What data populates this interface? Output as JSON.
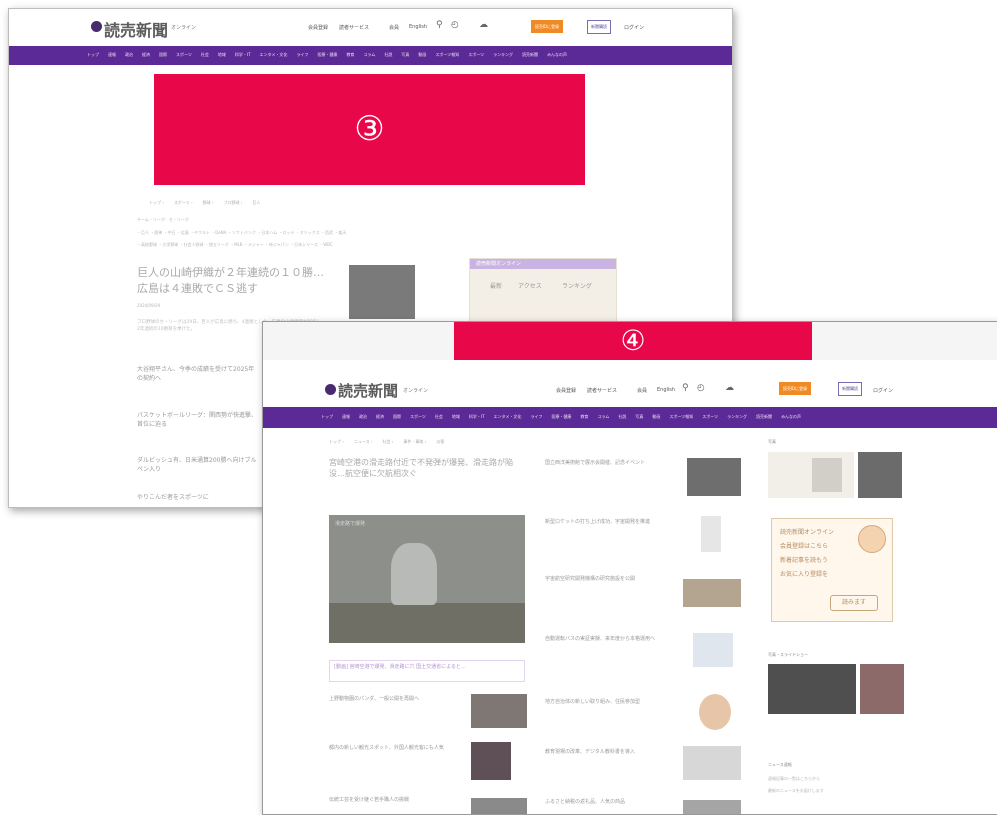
{
  "shot3": {
    "logo": "読売新聞",
    "logo_sub": "オンライン",
    "header_links": [
      "会員登録",
      "読者サービス",
      "会員",
      "English"
    ],
    "paid_button": "読売IDに登録",
    "box_button": "新聞購読",
    "login": "ログイン",
    "nav": [
      "トップ",
      "速報",
      "政治",
      "経済",
      "国際",
      "スポーツ",
      "社会",
      "地域",
      "科学・IT",
      "エンタメ・文化",
      "ライフ",
      "医療・健康",
      "教育",
      "コラム",
      "社説",
      "写真",
      "動画",
      "スポーツ報知",
      "スポーツ",
      "ランキング",
      "読売新聞",
      "みんなの声"
    ],
    "banner_label": "③",
    "breadcrumbs": [
      "トップ",
      "スポーツ",
      "野球",
      "プロ野球",
      "巨人"
    ],
    "tag_row_1": "チーム・リーグ：セ・リーグ",
    "tag_row_2": "・巨人 ・阪神 ・中日 ・広島 ・ヤクルト ・DeNA ・ソフトバンク ・日本ハム ・ロッテ ・オリックス ・西武 ・楽天",
    "tag_row_3": "・高校野球 ・大学野球 ・社会人野球 ・独立リーグ ・MLB ・メジャー ・侍ジャパン ・日本シリーズ ・WBC",
    "headline": "巨人の山崎伊織が２年連続の１０勝…広島は４連敗でＣＳ逃す",
    "date": "2024/09/29",
    "body_preview": "プロ野球のセ・リーグは29日、巨人が広島に勝ち、4連勝とした。先発の山崎伊織が好投し、2年連続の10勝目を挙げた。",
    "related": [
      "大谷翔平さん、今季の成績を受けて2025年の契約へ",
      "パスケットボールリーグ：関西勢が快進撃、首位に迫る",
      "ダルビッシュ有、日米通算200勝へ向けブルペン入り",
      "やりこんだ者をスポーツに"
    ],
    "widget_title": "読売新聞オンライン",
    "widget_tabs": [
      "最新",
      "アクセス",
      "ランキング"
    ]
  },
  "shot4": {
    "banner_label": "④",
    "logo": "読売新聞",
    "logo_sub": "オンライン",
    "header_links": [
      "会員登録",
      "読者サービス",
      "会員",
      "English"
    ],
    "paid_button": "読売IDに登録",
    "box_button": "新聞購読",
    "login": "ログイン",
    "nav": [
      "トップ",
      "速報",
      "政治",
      "経済",
      "国際",
      "スポーツ",
      "社会",
      "地域",
      "科学・IT",
      "エンタメ・文化",
      "ライフ",
      "医療・健康",
      "教育",
      "コラム",
      "社説",
      "写真",
      "動画",
      "スポーツ報知",
      "スポーツ",
      "ランキング",
      "読売新聞",
      "みんなの声"
    ],
    "breadcrumbs": [
      "トップ",
      "ニュース",
      "社会",
      "事件・事故",
      "災害"
    ],
    "headline": "宮崎空港の滑走路付近で不発弾が爆発、滑走路が陥没…航空便に欠航相次ぐ",
    "photo_caption": "滑走路で爆発",
    "photo_note": "[動画] 宮崎空港で爆発、滑走路に穴 国土交通省によると…",
    "side_news": [
      "国立西洋美術館で展示会開催、記念イベント",
      "新型ロケットの打ち上げ成功、宇宙開発を推進",
      "宇宙航空研究開発機構の研究施設を公開",
      "自動運転バスの実証実験、来年度から本格運用へ",
      "地方自治体の新しい取り組み、住民参加型",
      "教育現場の改革、デジタル教科書を導入",
      "ふるさと納税の返礼品、人気の商品"
    ],
    "left_news": [
      "上野動物園のパンダ、一般公開を再開へ",
      "都内の新しい観光スポット、外国人観光客にも人気",
      "伝統工芸を受け継ぐ若手職人の挑戦"
    ],
    "sidebar_title": "写真",
    "sidebar_sub": "写真・スライドショー",
    "note_lines": [
      "読売新聞オンライン",
      "会員登録はこちら",
      "新着記事を読もう",
      "お気に入り登録を"
    ],
    "note_button": "読みます",
    "bottom_title": "ニュース速報",
    "bottom_lines": [
      "速報記事の一覧はこちらから",
      "最新のニュースをお届けします"
    ]
  }
}
